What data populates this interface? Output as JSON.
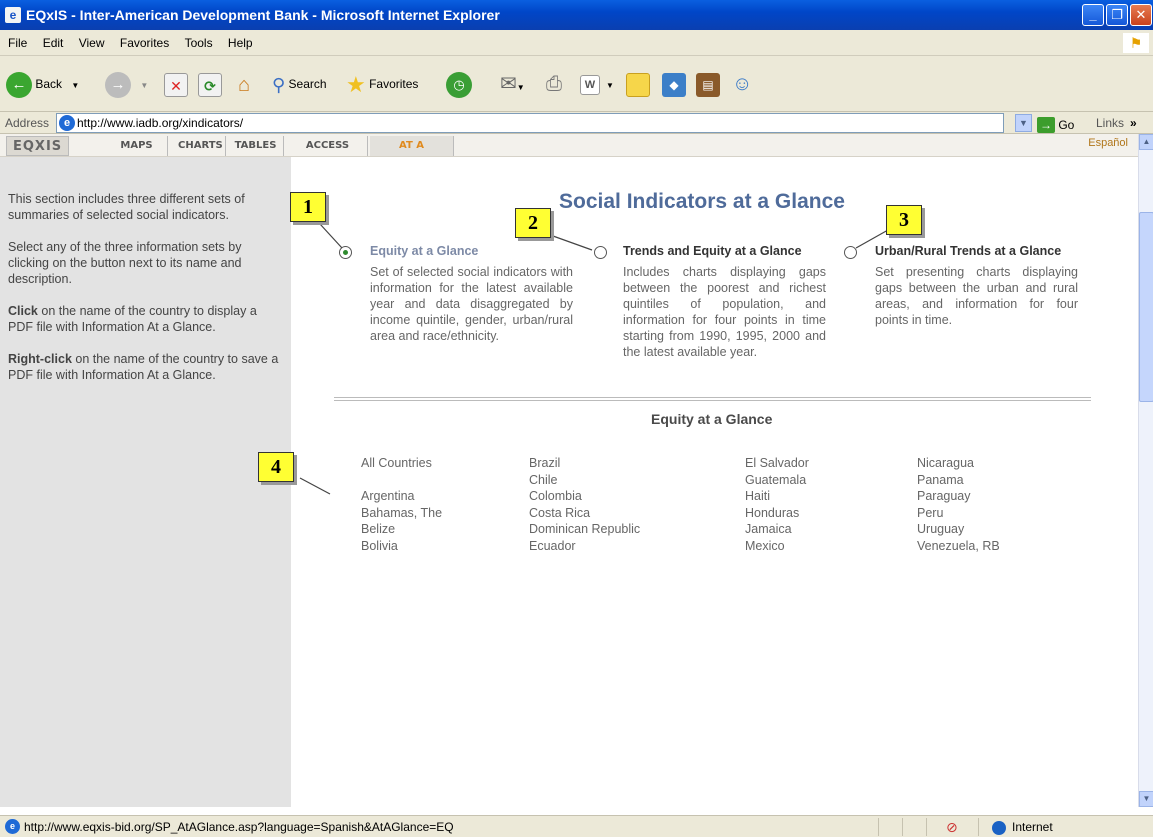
{
  "window": {
    "title": "EQxIS - Inter-American Development Bank - Microsoft Internet Explorer"
  },
  "menu": [
    "File",
    "Edit",
    "View",
    "Favorites",
    "Tools",
    "Help"
  ],
  "toolbar": {
    "back": "Back",
    "search": "Search",
    "favorites": "Favorites"
  },
  "address": {
    "label": "Address",
    "url": "http://www.iadb.org/xindicators/",
    "go": "Go",
    "links": "Links"
  },
  "site_nav": {
    "logo": "EQXIS",
    "tabs": [
      "MAPS",
      "CHARTS",
      "TABLES",
      "ACCESS GAPS",
      "AT A GLANCE"
    ],
    "language": "Español"
  },
  "sidebar": {
    "p1": "This section includes three different sets of summaries of selected social indicators.",
    "p2": "Select any of the three information sets by clicking on the button next to its name and description.",
    "p3_bold": "Click",
    "p3": " on the name of the country to display a PDF file with Information At a Glance.",
    "p4_bold": "Right-click",
    "p4": " on the name of the country to save a PDF file with Information At a Glance."
  },
  "main": {
    "heading": "Social Indicators at a Glance",
    "options": [
      {
        "title": "Equity at a Glance",
        "desc": "Set of selected social indicators with information for the latest available year and data disaggregated by income quintile, gender, urban/rural area and race/ethnicity.",
        "selected": true
      },
      {
        "title": "Trends and Equity at a Glance",
        "desc": "Includes charts displaying gaps between the poorest and richest quintiles of population, and information for four points in time starting from 1990, 1995, 2000 and the latest available year.",
        "selected": false
      },
      {
        "title": "Urban/Rural Trends at a Glance",
        "desc": "Set presenting charts displaying gaps between the urban and rural areas, and information for four points in time.",
        "selected": false
      }
    ],
    "subheading": "Equity at a Glance",
    "country_columns": [
      [
        "All Countries",
        "",
        "Argentina",
        "Bahamas, The",
        "Belize",
        "Bolivia"
      ],
      [
        "Brazil",
        "Chile",
        "Colombia",
        "Costa Rica",
        "Dominican Republic",
        "Ecuador"
      ],
      [
        "El Salvador",
        "Guatemala",
        "Haiti",
        "Honduras",
        "Jamaica",
        "Mexico"
      ],
      [
        "Nicaragua",
        "Panama",
        "Paraguay",
        "Peru",
        "Uruguay",
        "Venezuela, RB"
      ]
    ]
  },
  "callouts": [
    "1",
    "2",
    "3",
    "4"
  ],
  "status": {
    "url": "http://www.eqxis-bid.org/SP_AtAGlance.asp?language=Spanish&AtAGlance=EQ",
    "zone": "Internet"
  }
}
